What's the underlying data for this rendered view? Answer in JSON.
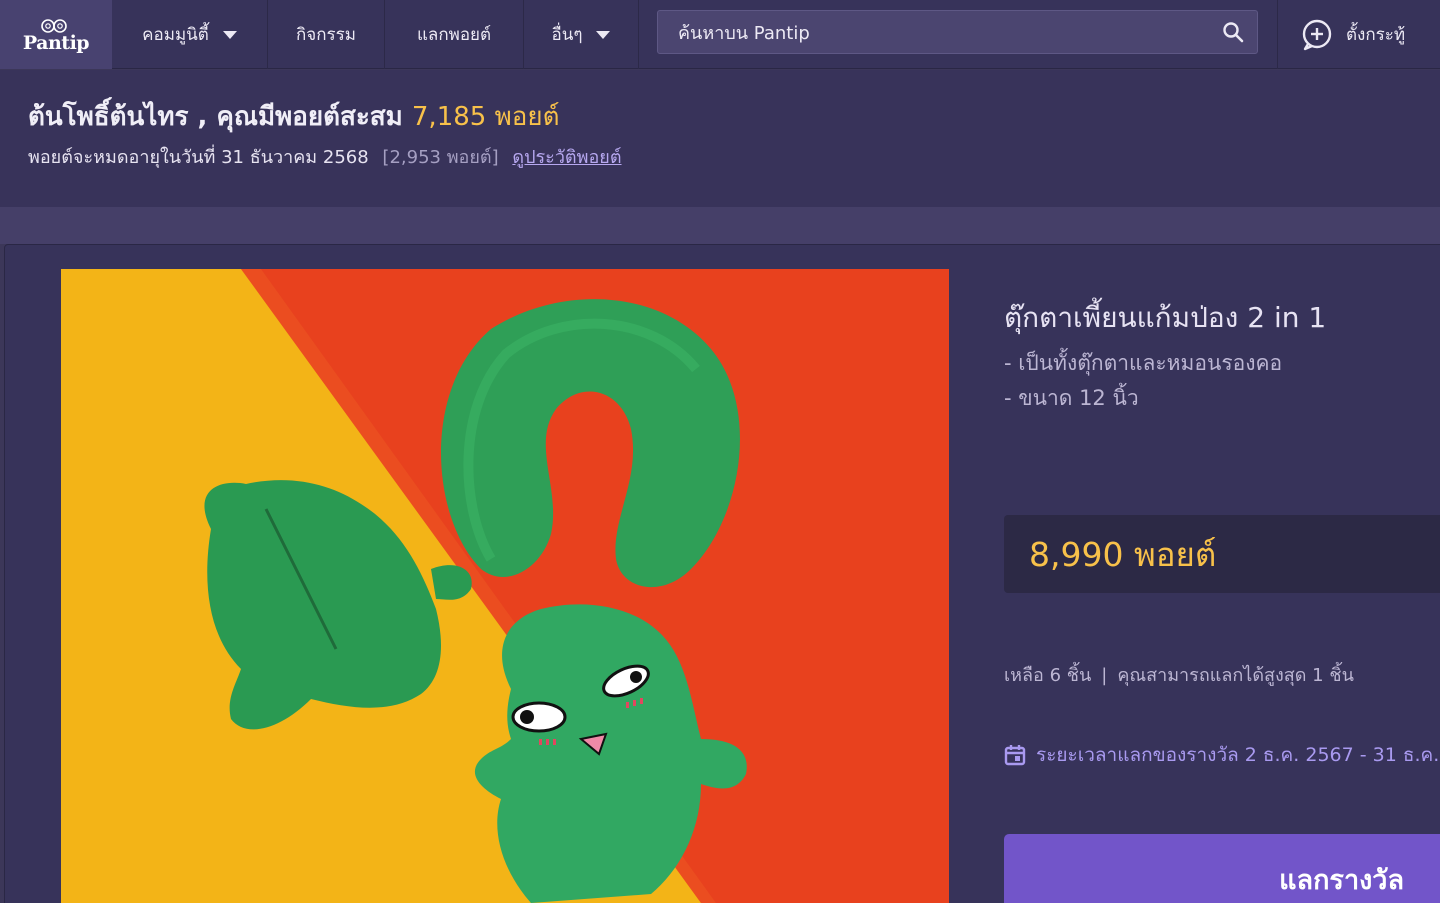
{
  "nav": {
    "logo_text": "Pantip",
    "items": [
      {
        "label": "คอมมูนิตี้",
        "has_dropdown": true
      },
      {
        "label": "กิจกรรม",
        "has_dropdown": false
      },
      {
        "label": "แลกพอยต์",
        "has_dropdown": false
      },
      {
        "label": "อื่นๆ",
        "has_dropdown": true
      }
    ],
    "search_placeholder": "ค้นหาบน Pantip",
    "search_icon": "search-icon",
    "post_label": "ตั้งกระทู้",
    "post_icon": "plus-chat-icon"
  },
  "points": {
    "user_line": "ต้นโพธิ์ต้นไทร , คุณมีพอยต์สะสม",
    "total": "7,185 พอยต์",
    "expire_text": "พอยต์จะหมดอายุในวันที่ 31 ธันวาคม 2568",
    "expire_amount": "[2,953 พอยต์]",
    "history_link": "ดูประวัติพอยต์"
  },
  "reward": {
    "title": "ตุ๊กตาเพี้ยนแก้มป่อง 2 in 1",
    "desc": [
      "- เป็นทั้งตุ๊กตาและหมอนรองคอ",
      "- ขนาด 12 นิ้ว"
    ],
    "price": "8,990 พอยต์",
    "stock_left": "เหลือ 6 ชิ้น",
    "stock_sep": "|",
    "stock_limit": "คุณสามารถแลกได้สูงสุด 1 ชิ้น",
    "period": "ระยะเวลาแลกของรางวัล 2 ธ.ค. 2567 - 31 ธ.ค.",
    "period_icon": "calendar-icon",
    "redeem_label": "แลกรางวัล"
  },
  "colors": {
    "nav_bg": "#37335a",
    "gold": "#f8c14a",
    "accent": "#7255c9",
    "link": "#b7a8f0"
  }
}
